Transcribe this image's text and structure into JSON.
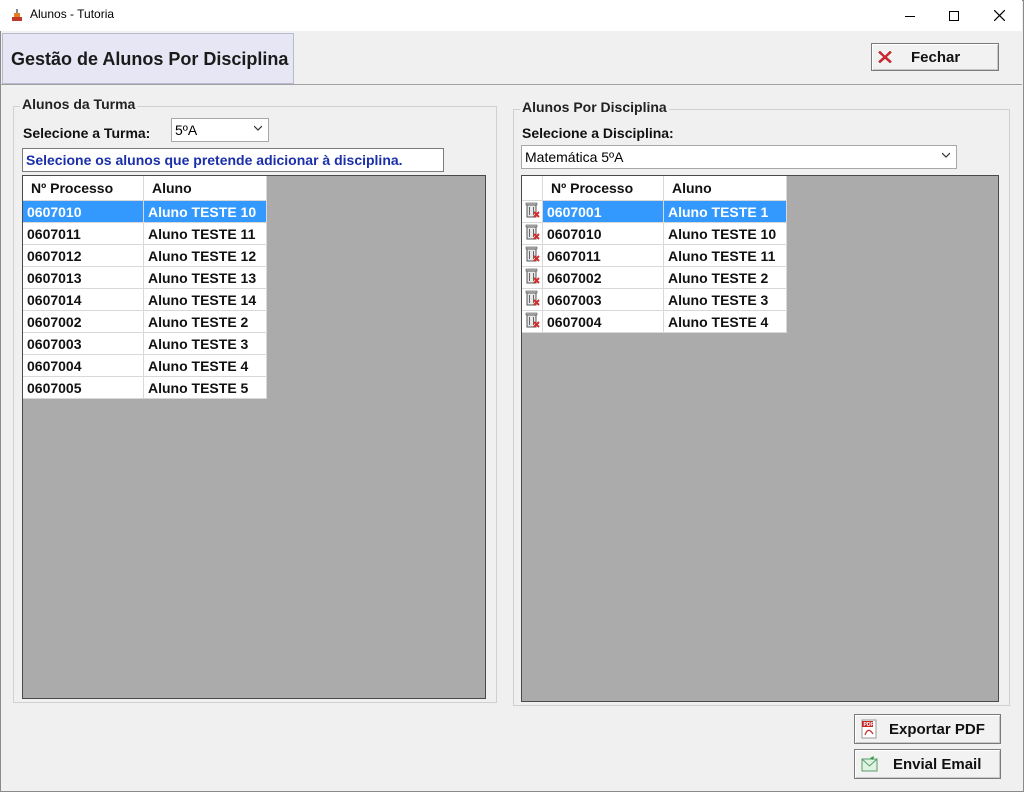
{
  "window": {
    "title": "Alunos - Tutoria"
  },
  "header": {
    "title": "Gestão de Alunos Por Disciplina",
    "close_label": "Fechar"
  },
  "left_group": {
    "title": "Alunos da Turma",
    "select_label": "Selecione a Turma:",
    "turma_value": "5ºA",
    "hint": "Selecione os alunos que pretende adicionar à disciplina.",
    "columns": [
      "Nº Processo",
      "Aluno"
    ],
    "rows": [
      [
        "0607010",
        "Aluno TESTE 10"
      ],
      [
        "0607011",
        "Aluno TESTE 11"
      ],
      [
        "0607012",
        "Aluno TESTE 12"
      ],
      [
        "0607013",
        "Aluno TESTE 13"
      ],
      [
        "0607014",
        "Aluno TESTE 14"
      ],
      [
        "0607002",
        "Aluno TESTE 2"
      ],
      [
        "0607003",
        "Aluno TESTE 3"
      ],
      [
        "0607004",
        "Aluno TESTE 4"
      ],
      [
        "0607005",
        "Aluno TESTE 5"
      ]
    ]
  },
  "right_group": {
    "title": "Alunos Por Disciplina",
    "select_label": "Selecione a Disciplina:",
    "disciplina_value": "Matemática 5ºA",
    "columns": [
      "Nº Processo",
      "Aluno"
    ],
    "rows": [
      [
        "0607001",
        "Aluno TESTE 1"
      ],
      [
        "0607010",
        "Aluno TESTE 10"
      ],
      [
        "0607011",
        "Aluno TESTE 11"
      ],
      [
        "0607002",
        "Aluno TESTE 2"
      ],
      [
        "0607003",
        "Aluno TESTE 3"
      ],
      [
        "0607004",
        "Aluno TESTE 4"
      ]
    ]
  },
  "actions": {
    "export_pdf": "Exportar PDF",
    "send_email": "Envial Email"
  },
  "colors": {
    "selection": "#3399ff",
    "hint_text": "#1a2fa8",
    "grid_background": "#ababab"
  }
}
